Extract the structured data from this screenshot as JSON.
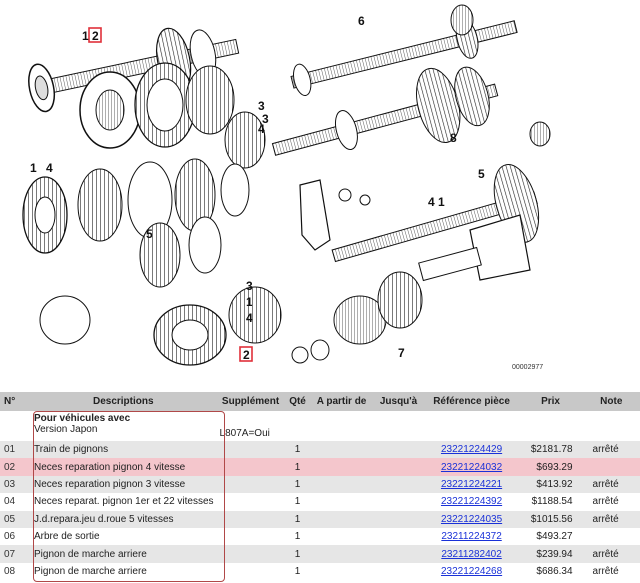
{
  "diagram": {
    "callouts": [
      "2",
      "1",
      "3",
      "6",
      "3",
      "4",
      "8",
      "1",
      "4",
      "5",
      "4",
      "1",
      "5",
      "3",
      "1",
      "4",
      "2",
      "7"
    ],
    "highlighted_callout": "2",
    "image_id": "00002977",
    "highlight_color": "#e0303a"
  },
  "table": {
    "headers": {
      "no": "N°",
      "description": "Descriptions",
      "supplement": "Supplément",
      "qty": "Qté",
      "from": "A partir de",
      "to": "Jusqu'à",
      "reference": "Référence pièce",
      "price": "Prix",
      "note": "Note"
    },
    "group": {
      "title": "Pour véhicules avec",
      "subtitle": "Version Japon",
      "supplement": "L807A=Oui"
    },
    "rows": [
      {
        "no": "01",
        "description": "Train de pignons",
        "qty": "1",
        "reference": "23221224429",
        "price": "$2181.78",
        "note": "arrêté"
      },
      {
        "no": "02",
        "description": "Neces reparation pignon 4 vitesse",
        "qty": "1",
        "reference": "23221224032",
        "price": "$693.29",
        "note": ""
      },
      {
        "no": "03",
        "description": "Neces reparation pignon 3 vitesse",
        "qty": "1",
        "reference": "23221224221",
        "price": "$413.92",
        "note": "arrêté"
      },
      {
        "no": "04",
        "description": "Neces reparat. pignon 1er et 22 vitesses",
        "qty": "1",
        "reference": "23221224392",
        "price": "$1188.54",
        "note": "arrêté"
      },
      {
        "no": "05",
        "description": "J.d.repara.jeu d.roue 5 vitesses",
        "qty": "1",
        "reference": "23221224035",
        "price": "$1015.56",
        "note": "arrêté"
      },
      {
        "no": "06",
        "description": "Arbre de sortie",
        "qty": "1",
        "reference": "23211224372",
        "price": "$493.27",
        "note": ""
      },
      {
        "no": "07",
        "description": "Pignon de marche arriere",
        "qty": "1",
        "reference": "23211282402",
        "price": "$239.94",
        "note": "arrêté"
      },
      {
        "no": "08",
        "description": "Pignon de marche arriere",
        "qty": "1",
        "reference": "23221224268",
        "price": "$686.34",
        "note": "arrêté"
      }
    ],
    "highlighted_row": "02",
    "colors": {
      "header_bg": "#c8c8c8",
      "zebra_bg": "#e6e6e6",
      "highlight_bg": "#f4c6cc",
      "link": "#1a31d8"
    }
  }
}
